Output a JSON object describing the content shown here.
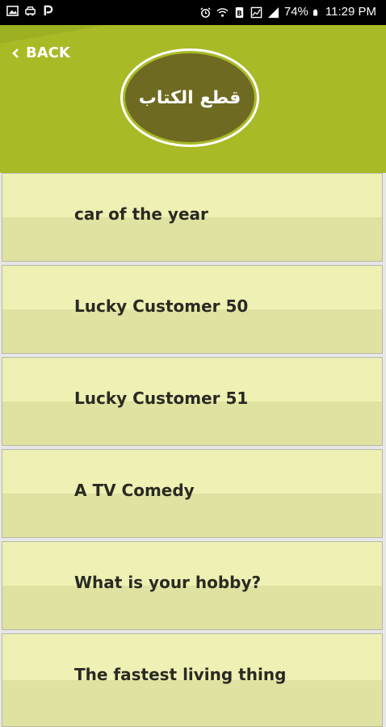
{
  "status_bar": {
    "battery": "74%",
    "time": "11:29 PM"
  },
  "header": {
    "back_label": "BACK",
    "title": "قطع الكتاب"
  },
  "list": {
    "items": [
      {
        "label": "car of the year"
      },
      {
        "label": "Lucky Customer 50"
      },
      {
        "label": "Lucky Customer 51"
      },
      {
        "label": "A TV Comedy"
      },
      {
        "label": "What is your hobby?"
      },
      {
        "label": "The fastest living thing"
      }
    ]
  },
  "colors": {
    "header_bg": "#9db021",
    "title_circle": "#6e6a22",
    "item_light": "#eef0b4",
    "item_dark": "#dfe2a0"
  }
}
